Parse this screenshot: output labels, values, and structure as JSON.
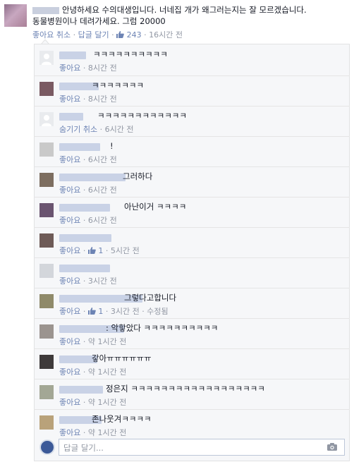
{
  "post": {
    "text_line1": "안녕하세요 수의대생입니다. 너네집 개가 왜그러는지는 잘 모르겠습니다.",
    "text_line2": "동물병원이나 데려가세요. 그럼 20000",
    "like_label": "좋아요 취소",
    "reply_label": "답글 달기",
    "like_count": "243",
    "time": "16시간 전"
  },
  "comments": [
    {
      "text": "ㅋㅋㅋㅋㅋㅋㅋㅋㅋㅋ",
      "action": "좋아요",
      "likes": "",
      "time": "8시간 전"
    },
    {
      "text": "ㅋㅋㅋㅋㅋㅋㅋ",
      "action": "좋아요",
      "likes": "",
      "time": "8시간 전"
    },
    {
      "text": "ㅋㅋㅋㅋㅋㅋㅋㅋㅋㅋㅋㅋ",
      "action": "숨기기 취소",
      "likes": "",
      "time": "6시간 전"
    },
    {
      "text": "!",
      "action": "좋아요",
      "likes": "",
      "time": "6시간 전"
    },
    {
      "text": "그러하다",
      "action": "좋아요",
      "likes": "",
      "time": "6시간 전"
    },
    {
      "text": "아난이거 ㅋㅋㅋㅋ",
      "action": "좋아요",
      "likes": "",
      "time": "6시간 전"
    },
    {
      "text": "",
      "action": "좋아요",
      "likes": "1",
      "time": "5시간 전"
    },
    {
      "text": "",
      "action": "좋아요",
      "likes": "",
      "time": "3시간 전"
    },
    {
      "text": "그렇다고합니다",
      "action": "좋아요",
      "likes": "1",
      "time": "3시간 전",
      "edited": "수정됨"
    },
    {
      "text": ": 악핳았다 ㅋㅋㅋㅋㅋㅋㅋㅋㅋㅋ",
      "action": "좋아요",
      "likes": "",
      "time": "약 1시간 전"
    },
    {
      "text": "갛아ㅠㅠㅠㅠㅠㅠ",
      "action": "좋아요",
      "likes": "",
      "time": "약 1시간 전"
    },
    {
      "text": "정은지 ㅋㅋㅋㅋㅋㅋㅋㅋㅋㅋㅋㅋㅋㅋㅋㅋㅋㅋ",
      "action": "좋아요",
      "likes": "",
      "time": "약 1시간 전"
    },
    {
      "text": "존나웃겨ㅋㅋㅋㅋ",
      "action": "좋아요",
      "likes": "",
      "time": "약 1시간 전"
    }
  ],
  "reply": {
    "placeholder": "답글 달기..."
  },
  "colors": {
    "link": "#6d84b4",
    "meta_gray": "#9197a3",
    "panel_bg": "#f6f7f9"
  },
  "icons": {
    "thumb": "thumbs-up-icon",
    "camera": "camera-icon"
  }
}
